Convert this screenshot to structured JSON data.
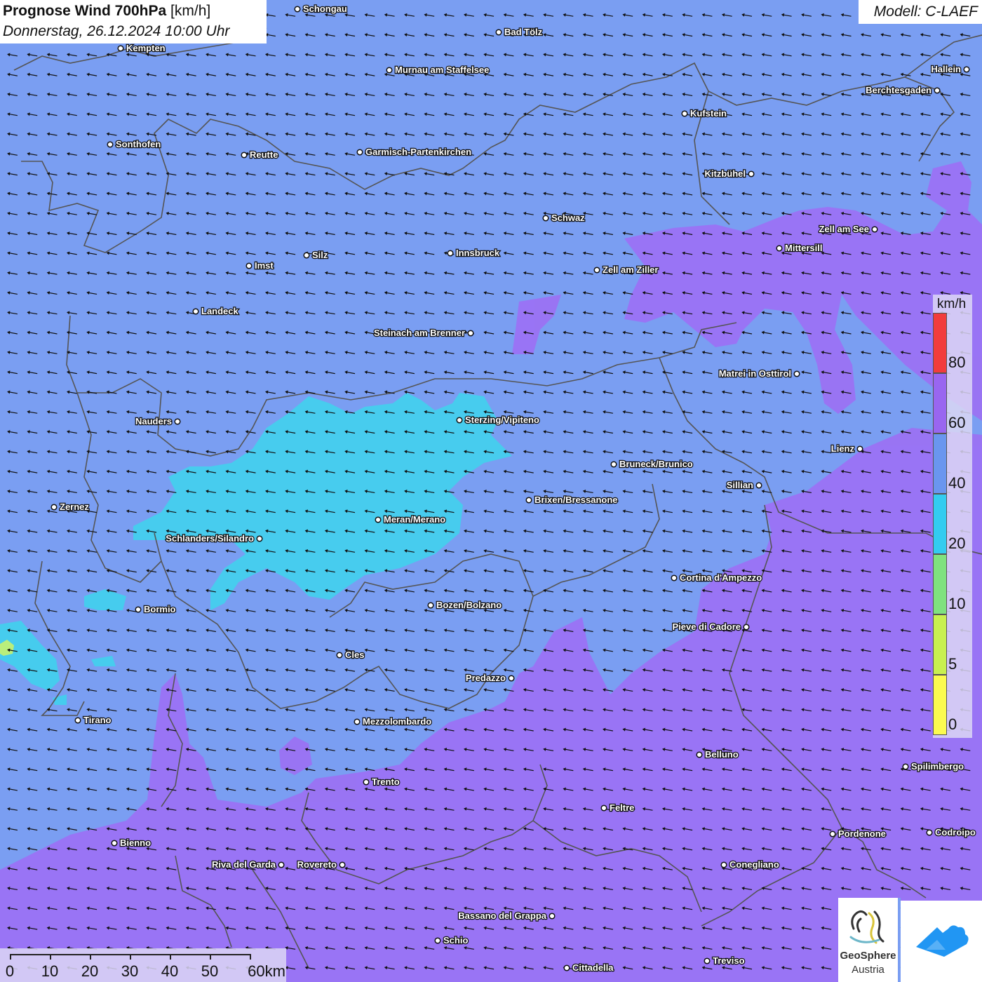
{
  "header": {
    "title_bold": "Prognose Wind 700hPa",
    "title_unit": "[km/h]",
    "datetime": "Donnerstag, 26.12.2024 10:00 Uhr",
    "model": "Modell: C-LAEF"
  },
  "legend": {
    "unit": "km/h",
    "classes": [
      {
        "label": "0",
        "color": "#fbfb50"
      },
      {
        "label": "5",
        "color": "#c8f050"
      },
      {
        "label": "10",
        "color": "#7fe27f"
      },
      {
        "label": "20",
        "color": "#33ccf0"
      },
      {
        "label": "40",
        "color": "#6a96ef"
      },
      {
        "label": "60",
        "color": "#9966f0"
      },
      {
        "label": "80",
        "color": "#f23c3c"
      }
    ]
  },
  "scale_bar": {
    "labels": [
      "0",
      "10",
      "20",
      "30",
      "40",
      "50",
      "60km"
    ]
  },
  "logos": {
    "geosphere_line1": "GeoSphere",
    "geosphere_line2": "Austria"
  },
  "colors": {
    "band_20_40": "#42d0ee",
    "band_40_60": "#7a9ef2",
    "band_60_80": "#9b72f4",
    "band_5_10": "#b9ee7c",
    "arrow": "#111111",
    "border": "#555555"
  },
  "wind": {
    "direction": "from the east-northeast, arrows pointing west-southwest"
  },
  "places": [
    {
      "name": "Schongau"
    },
    {
      "name": "Bad Tölz"
    },
    {
      "name": "Kempten"
    },
    {
      "name": "Murnau am Staffelsee"
    },
    {
      "name": "Hallein"
    },
    {
      "name": "Berchtesgaden"
    },
    {
      "name": "Kufstein"
    },
    {
      "name": "Sonthofen"
    },
    {
      "name": "Reutte"
    },
    {
      "name": "Garmisch-Partenkirchen"
    },
    {
      "name": "Kitzbühel"
    },
    {
      "name": "Schwaz"
    },
    {
      "name": "Zell am See"
    },
    {
      "name": "Mittersill"
    },
    {
      "name": "Silz"
    },
    {
      "name": "Innsbruck"
    },
    {
      "name": "Imst"
    },
    {
      "name": "Zell am Ziller"
    },
    {
      "name": "Landeck"
    },
    {
      "name": "Steinach am Brenner"
    },
    {
      "name": "Matrei in Osttirol"
    },
    {
      "name": "Nauders"
    },
    {
      "name": "Sterzing/Vipiteno"
    },
    {
      "name": "Lienz"
    },
    {
      "name": "Bruneck/Brunico"
    },
    {
      "name": "Sillian"
    },
    {
      "name": "Zernez"
    },
    {
      "name": "Brixen/Bressanone"
    },
    {
      "name": "Meran/Merano"
    },
    {
      "name": "Schlanders/Silandro"
    },
    {
      "name": "Cortina d'Ampezzo"
    },
    {
      "name": "Bormio"
    },
    {
      "name": "Bozen/Bolzano"
    },
    {
      "name": "Pieve di Cadore"
    },
    {
      "name": "Cles"
    },
    {
      "name": "Predazzo"
    },
    {
      "name": "Tirano"
    },
    {
      "name": "Mezzolombardo"
    },
    {
      "name": "Belluno"
    },
    {
      "name": "Spilimbergo"
    },
    {
      "name": "Trento"
    },
    {
      "name": "Feltre"
    },
    {
      "name": "Pordenone"
    },
    {
      "name": "Codroipo"
    },
    {
      "name": "Bienno"
    },
    {
      "name": "Riva del Garda"
    },
    {
      "name": "Rovereto"
    },
    {
      "name": "Conegliano"
    },
    {
      "name": "Bassano del Grappa"
    },
    {
      "name": "Schio"
    },
    {
      "name": "Treviso"
    },
    {
      "name": "Cittadella"
    }
  ]
}
